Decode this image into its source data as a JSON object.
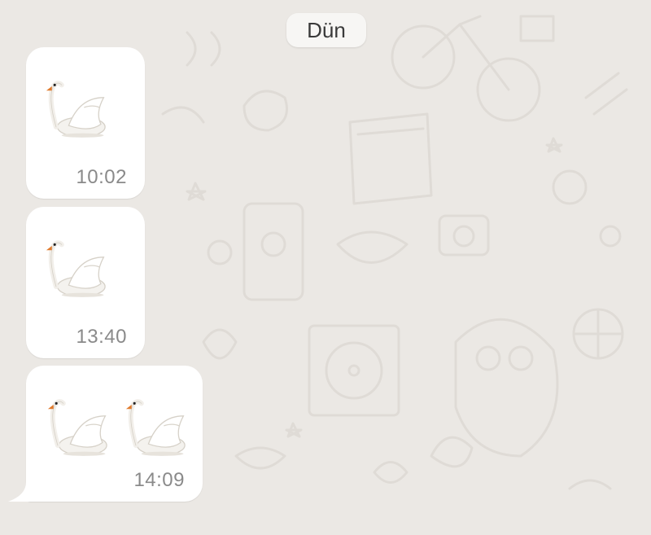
{
  "chat": {
    "date_separator": "Dün",
    "messages": [
      {
        "emoji": "swan-icon",
        "count": 1,
        "time": "10:02"
      },
      {
        "emoji": "swan-icon",
        "count": 1,
        "time": "13:40"
      },
      {
        "emoji": "swan-icon",
        "count": 2,
        "time": "14:09"
      }
    ]
  },
  "colors": {
    "wallpaper": "#ebe8e4",
    "bubble": "#ffffff",
    "timestamp": "#8a8a8a"
  }
}
